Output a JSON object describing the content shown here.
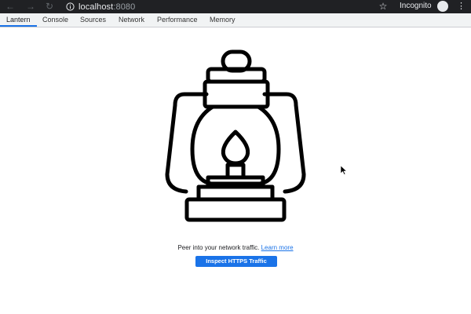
{
  "browser": {
    "host": "localhost",
    "port": ":8080",
    "incognito_label": "Incognito",
    "nav_icons": [
      "back-arrow-icon",
      "forward-arrow-icon",
      "reload-icon"
    ],
    "accent": "#1a73e8",
    "chrome_bg": "#202124"
  },
  "devtools": {
    "tabs": [
      {
        "label": "Lantern",
        "active": true
      },
      {
        "label": "Console"
      },
      {
        "label": "Sources"
      },
      {
        "label": "Network"
      },
      {
        "label": "Performance"
      },
      {
        "label": "Memory"
      }
    ]
  },
  "main": {
    "prompt_text": "Peer into your network traffic.",
    "learn_more": "Learn more",
    "cta_label": "Inspect HTTPS Traffic",
    "illustration": "lantern-icon"
  }
}
